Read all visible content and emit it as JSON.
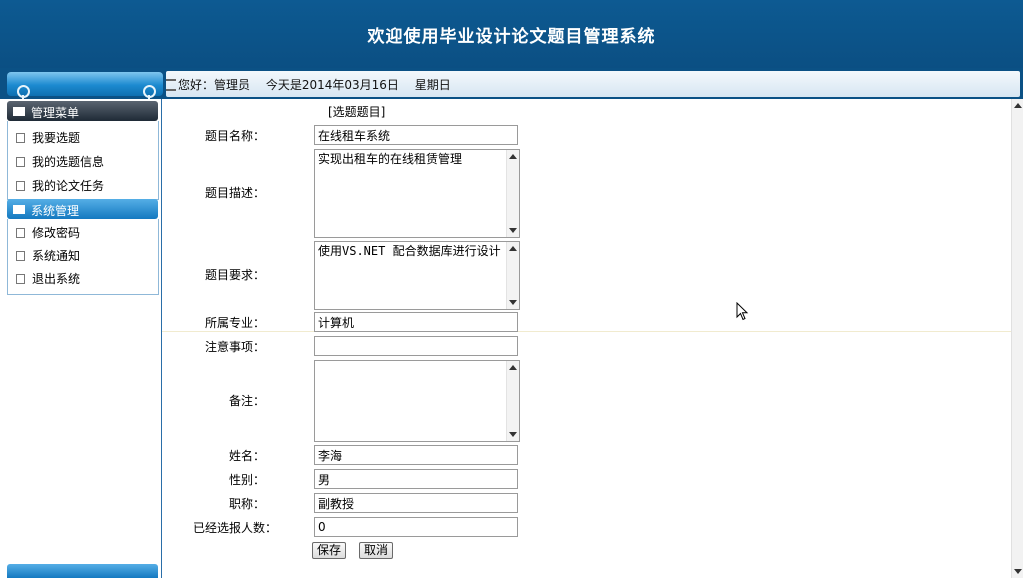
{
  "app": {
    "title": "欢迎使用毕业设计论文题目管理系统"
  },
  "topbar": {
    "greeting": "您好：管理员　 今天是2014年03月16日　 星期日"
  },
  "sidebar": {
    "menu_header": "管理菜单",
    "items": [
      {
        "label": "我要选题"
      },
      {
        "label": "我的选题信息"
      },
      {
        "label": "我的论文任务"
      }
    ],
    "system_header": "系统管理",
    "system_items": [
      {
        "label": "修改密码"
      },
      {
        "label": "系统通知"
      },
      {
        "label": "退出系统"
      }
    ]
  },
  "form": {
    "title": "[选题题目]",
    "fields": {
      "topic_name": {
        "label": "题目名称：",
        "value": "在线租车系统"
      },
      "topic_desc": {
        "label": "题目描述：",
        "value": "实现出租车的在线租赁管理"
      },
      "topic_req": {
        "label": "题目要求：",
        "value": "使用VS.NET 配合数据库进行设计"
      },
      "major": {
        "label": "所属专业：",
        "value": "计算机"
      },
      "notes": {
        "label": "注意事项：",
        "value": ""
      },
      "remark": {
        "label": "备注：",
        "value": ""
      },
      "name": {
        "label": "姓名：",
        "value": "李海"
      },
      "gender": {
        "label": "性别：",
        "value": "男"
      },
      "title_rank": {
        "label": "职称：",
        "value": "副教授"
      },
      "selected_count": {
        "label": "已经选报人数：",
        "value": "0"
      }
    },
    "save_label": "保存",
    "cancel_label": "取消"
  },
  "colors": {
    "banner": "#0d5a92",
    "sidebar_header": "#1479c0",
    "border": "#9a9a9a"
  },
  "icons": [
    "greeting-icon",
    "menu-grid-icon",
    "document-icon",
    "system-icon",
    "mouse-cursor-icon"
  ]
}
